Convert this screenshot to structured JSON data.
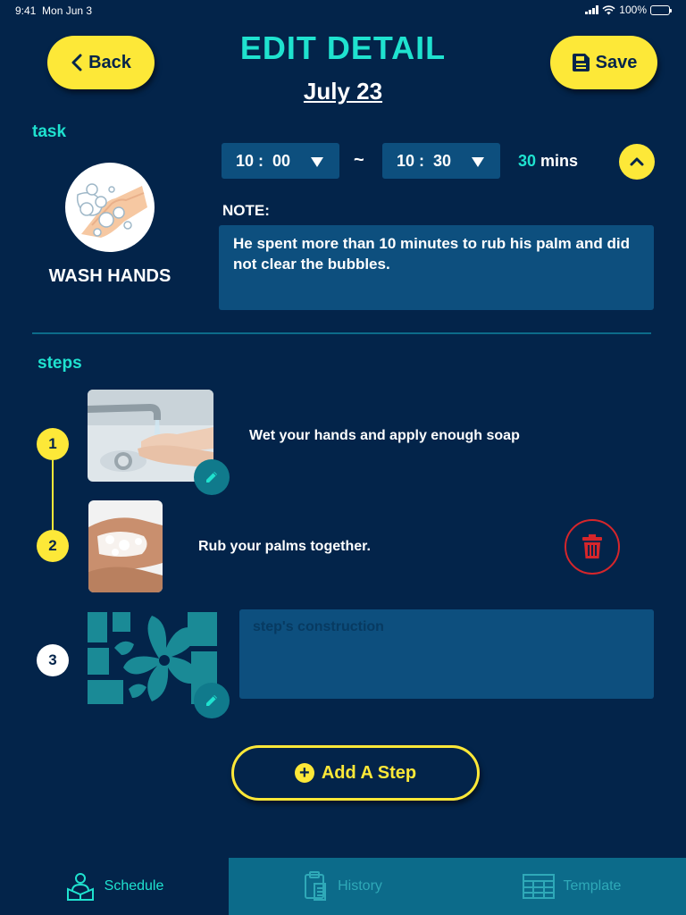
{
  "status_bar": {
    "time": "9:41",
    "date": "Mon Jun 3",
    "battery": "100%"
  },
  "header": {
    "back_label": "Back",
    "title": "EDIT DETAIL",
    "date": "July 23",
    "save_label": "Save"
  },
  "task": {
    "section_label": "task",
    "name": "WASH HANDS",
    "start_time": "10 :  00",
    "end_time": "10 :  30",
    "separator": "~",
    "duration_value": "30",
    "duration_unit": "mins",
    "note_label": "NOTE:",
    "note": "He spent more than 10 minutes to rub his palm and did not clear the bubbles."
  },
  "steps": {
    "section_label": "steps",
    "items": [
      {
        "number": "1",
        "text": "Wet your hands and apply enough soap"
      },
      {
        "number": "2",
        "text": "Rub your palms together."
      },
      {
        "number": "3",
        "placeholder": "step's construction"
      }
    ],
    "add_label": "Add A Step"
  },
  "tabs": [
    {
      "label": "Schedule",
      "icon": "reading-person-icon",
      "active": true
    },
    {
      "label": "History",
      "icon": "clipboard-icon",
      "active": false
    },
    {
      "label": "Template",
      "icon": "table-icon",
      "active": false
    }
  ],
  "colors": {
    "background": "#03244a",
    "accent_yellow": "#fde838",
    "accent_teal": "#1fe2cf",
    "field": "#0d4f7e",
    "delete_red": "#d6262b"
  }
}
